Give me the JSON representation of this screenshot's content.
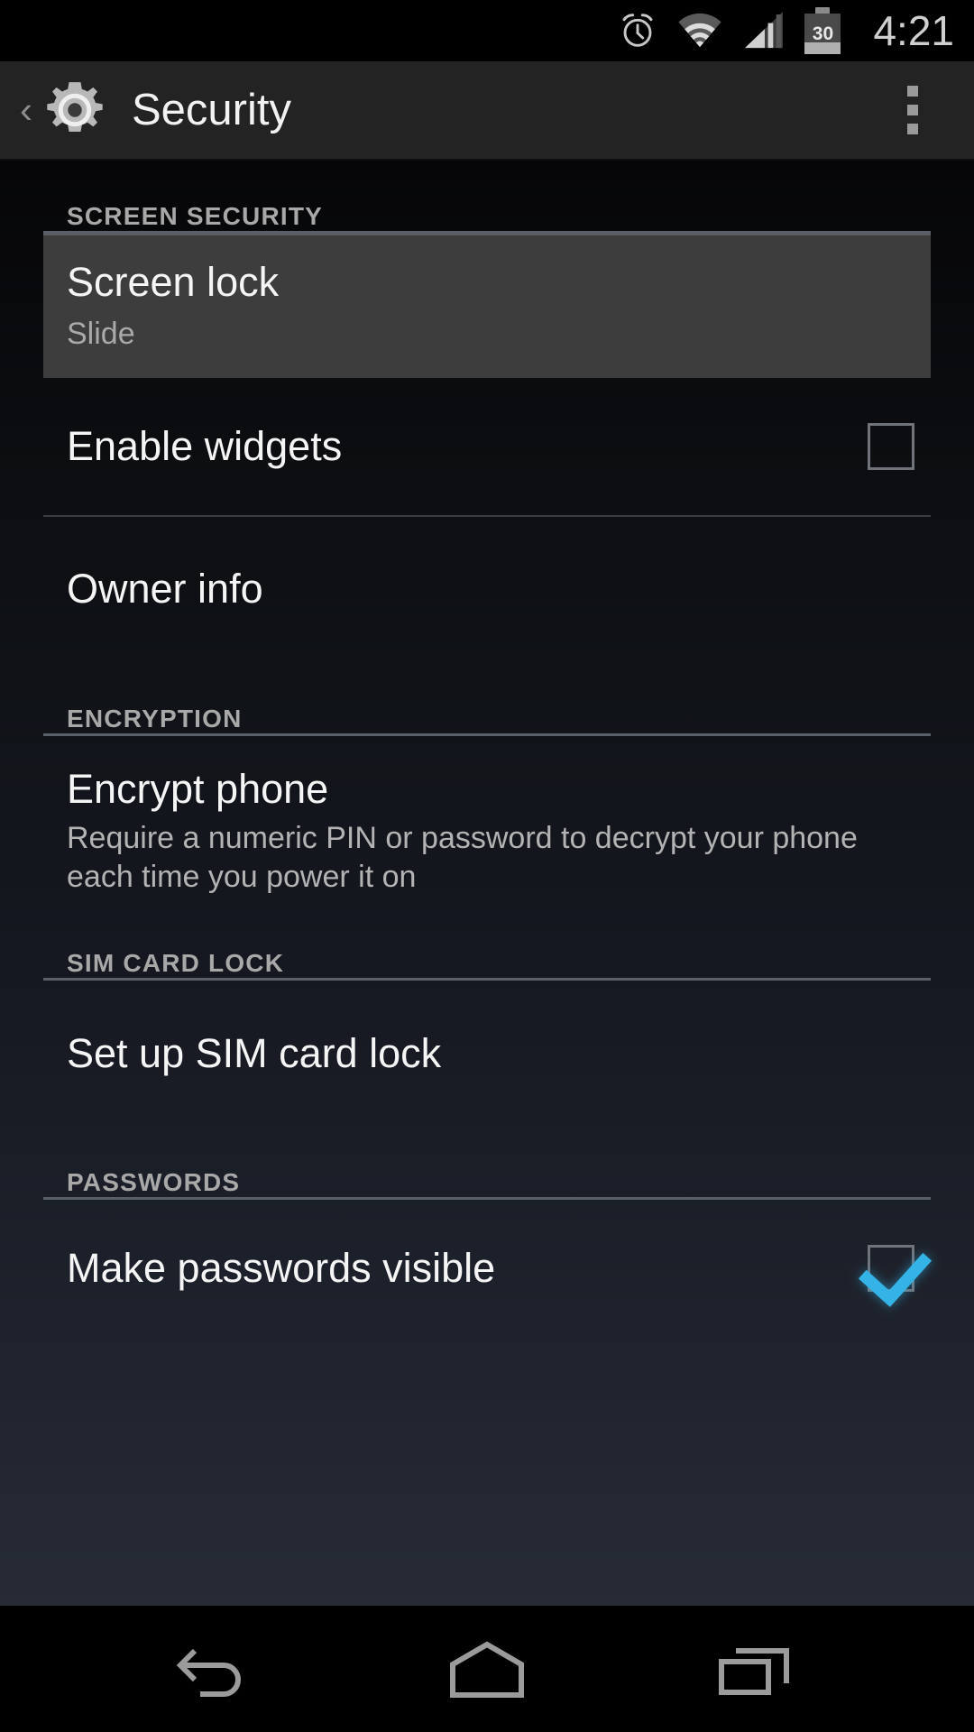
{
  "status_bar": {
    "alarm_icon": "alarm-clock-icon",
    "wifi_icon": "wifi-icon",
    "signal_icon": "cell-signal-icon",
    "battery_icon": "battery-icon",
    "battery_level": "30",
    "time": "4:21"
  },
  "action_bar": {
    "up_chevron": "‹",
    "app_icon": "settings-gear-icon",
    "title": "Security",
    "overflow_icon": "overflow-menu-icon"
  },
  "sections": [
    {
      "header": "SCREEN SECURITY",
      "items": [
        {
          "title": "Screen lock",
          "summary": "Slide",
          "selected": true
        },
        {
          "title": "Enable widgets",
          "checkbox": "unchecked"
        },
        {
          "title": "Owner info"
        }
      ]
    },
    {
      "header": "ENCRYPTION",
      "items": [
        {
          "title": "Encrypt phone",
          "description": "Require a numeric PIN or password to decrypt your phone each time you power it on"
        }
      ]
    },
    {
      "header": "SIM CARD LOCK",
      "items": [
        {
          "title": "Set up SIM card lock"
        }
      ]
    },
    {
      "header": "PASSWORDS",
      "items": [
        {
          "title": "Make passwords visible",
          "checkbox": "checked"
        }
      ]
    }
  ],
  "nav_bar": {
    "back": "back-icon",
    "home": "home-icon",
    "recents": "recents-icon"
  },
  "colors": {
    "accent": "#33b5e5",
    "action_bar_bg": "#232323",
    "selected_row_bg": "#3d3d3d",
    "section_header_text": "#a8a8a8"
  }
}
